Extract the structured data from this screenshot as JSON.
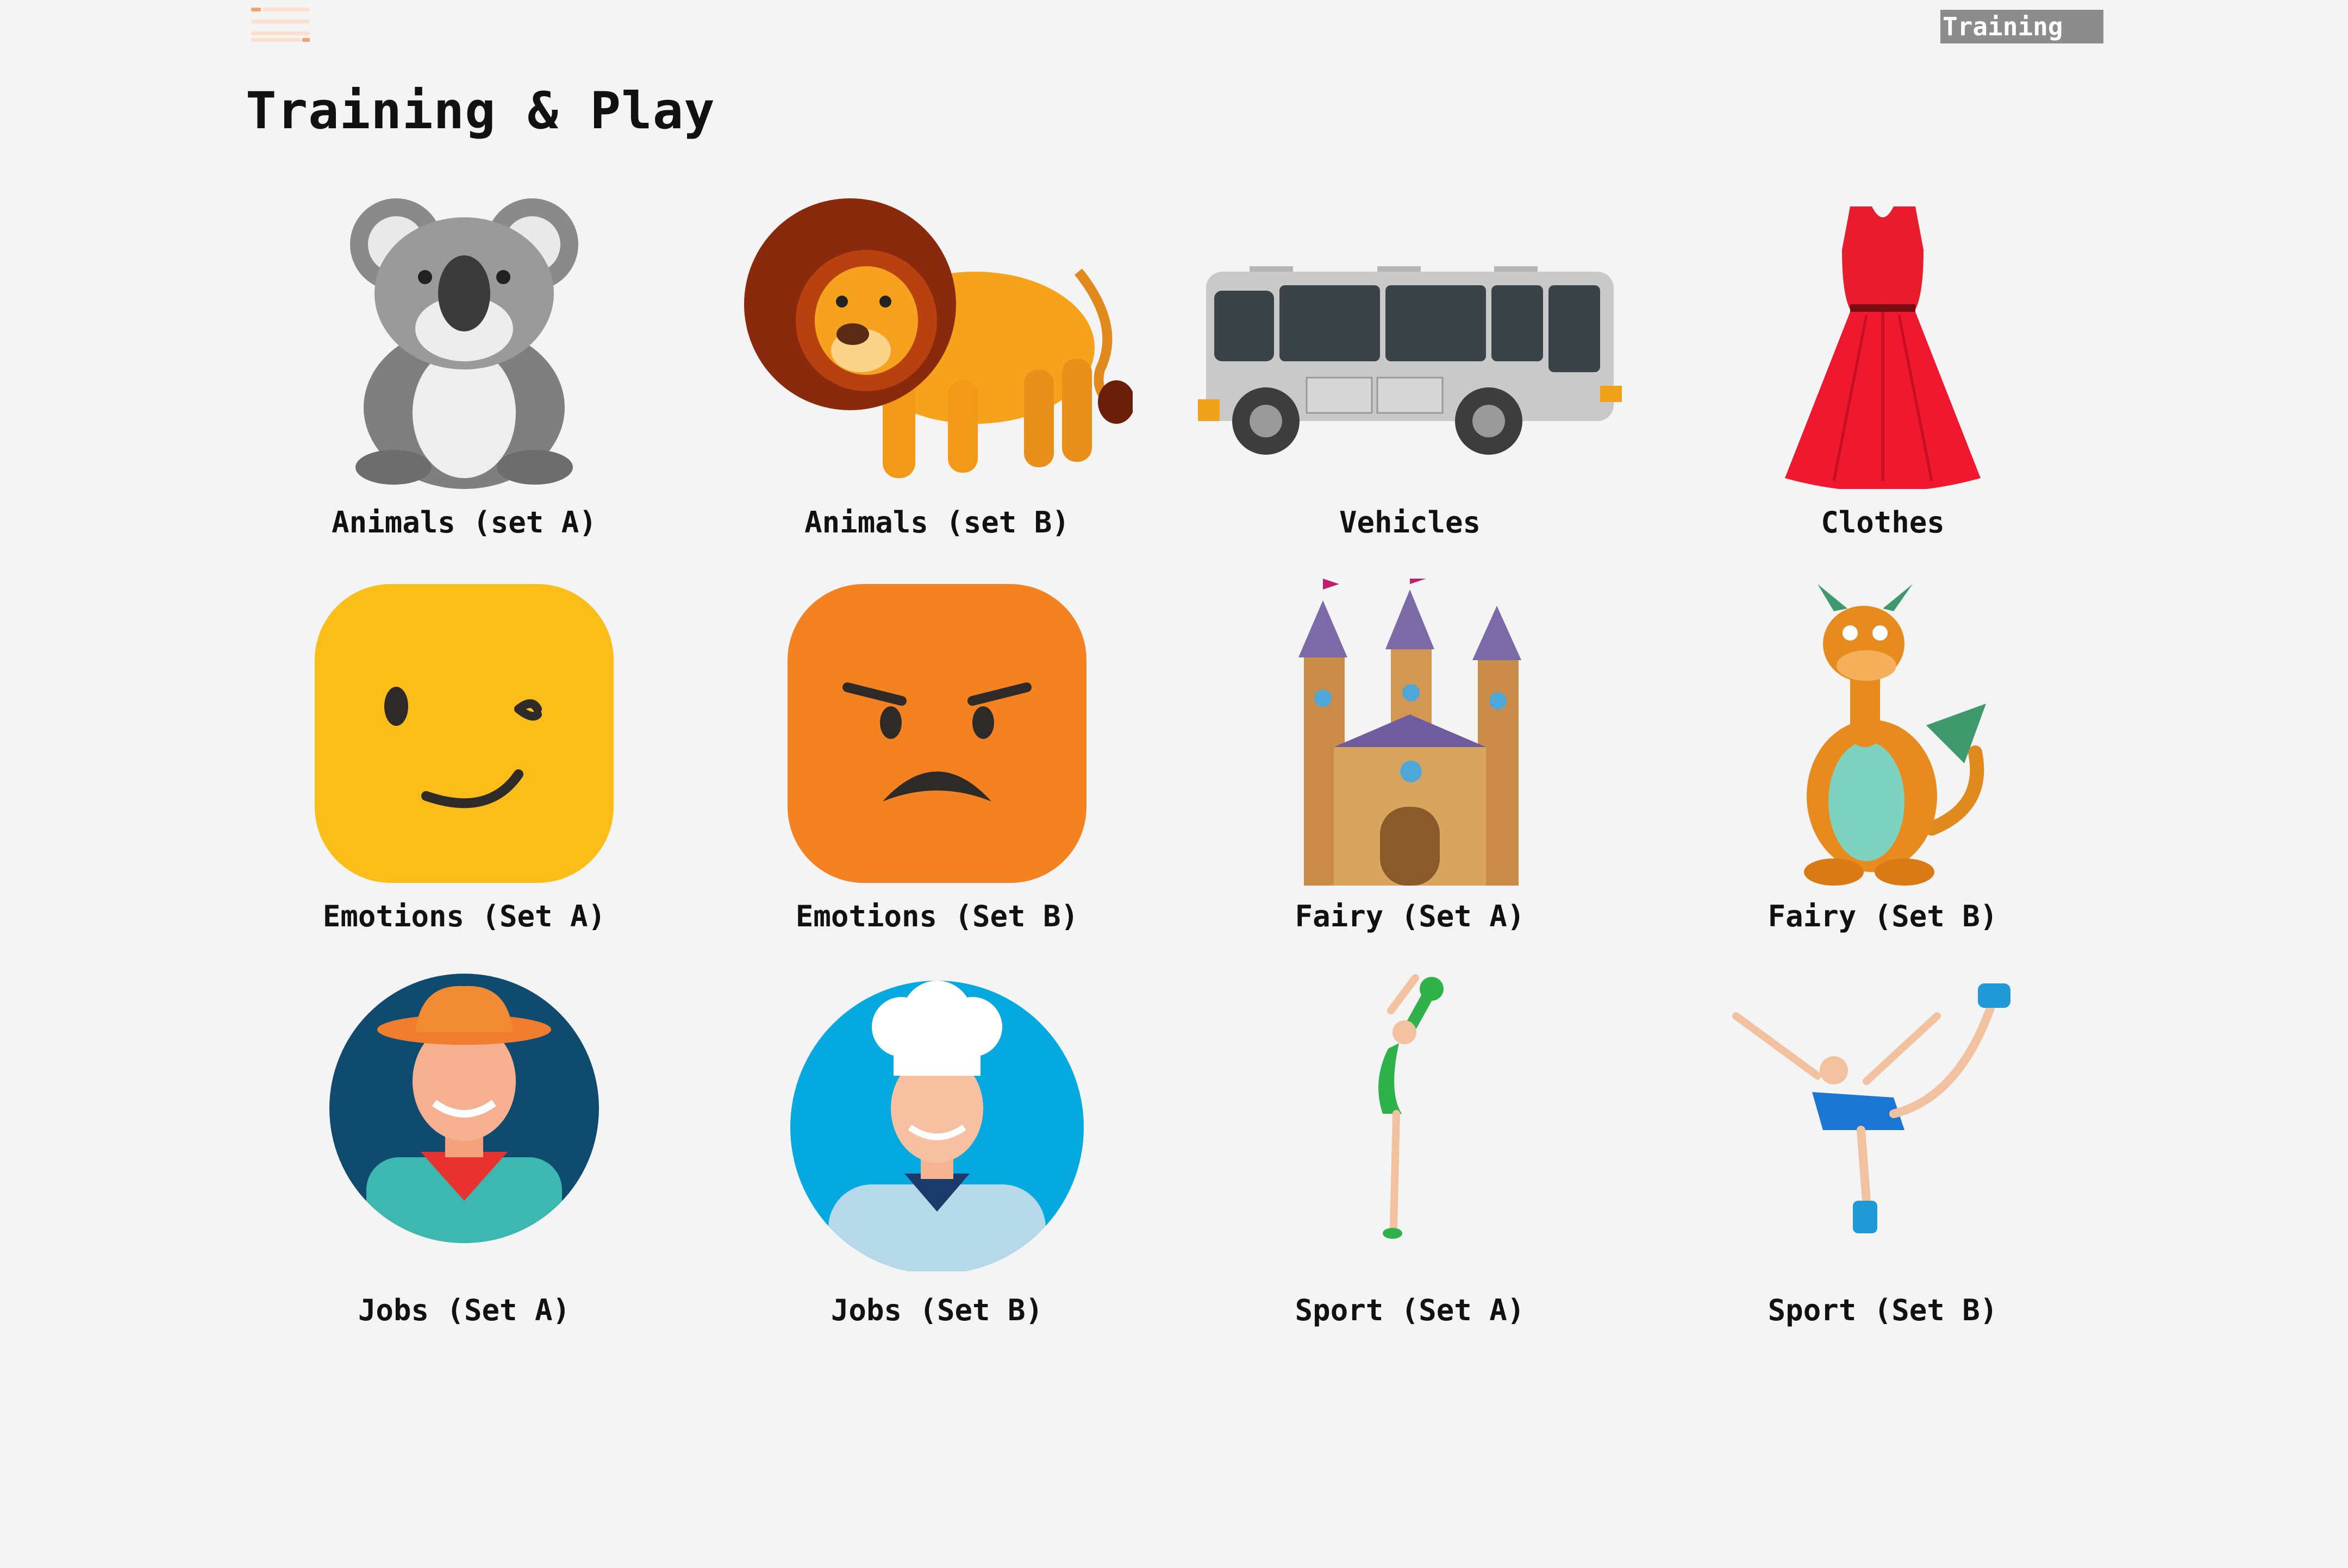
{
  "header": {
    "menu_icon": "hamburger-menu-icon",
    "training_tab": "Training"
  },
  "page": {
    "title": "Training & Play"
  },
  "colors": {
    "menu_accent": "#f4a373",
    "tab_bg": "#8c8c8c",
    "background": "#f4f4f4"
  },
  "categories": [
    {
      "label": "Animals (set A)",
      "icon": "koala-icon"
    },
    {
      "label": "Animals (set B)",
      "icon": "lion-icon"
    },
    {
      "label": "Vehicles",
      "icon": "bus-icon"
    },
    {
      "label": "Clothes",
      "icon": "red-dress-icon"
    },
    {
      "label": "Emotions (Set A)",
      "icon": "winking-face-icon"
    },
    {
      "label": "Emotions (Set B)",
      "icon": "angry-face-icon"
    },
    {
      "label": "Fairy (Set A)",
      "icon": "castle-icon"
    },
    {
      "label": "Fairy (Set B)",
      "icon": "dragon-icon"
    },
    {
      "label": "Jobs (Set A)",
      "icon": "cowboy-icon"
    },
    {
      "label": "Jobs (Set B)",
      "icon": "chef-icon"
    },
    {
      "label": "Sport (Set A)",
      "icon": "gymnast-icon"
    },
    {
      "label": "Sport (Set B)",
      "icon": "figure-skater-icon"
    }
  ]
}
